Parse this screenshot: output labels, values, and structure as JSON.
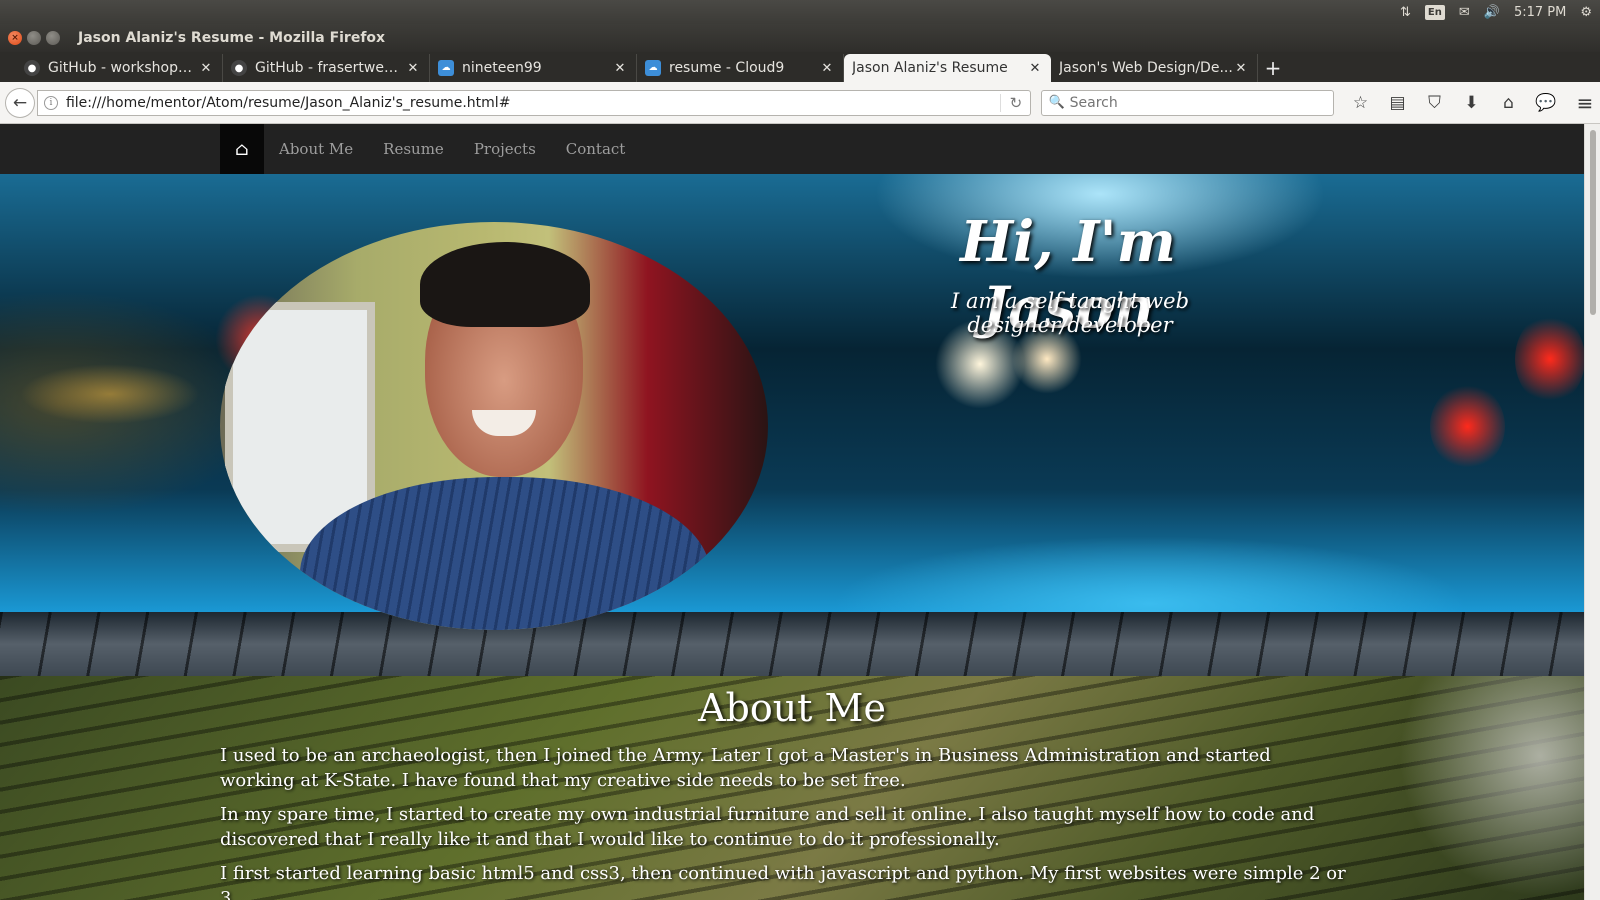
{
  "system": {
    "lang": "En",
    "clock": "5:17 PM"
  },
  "window": {
    "title": "Jason Alaniz's Resume - Mozilla Firefox"
  },
  "tabs": [
    {
      "label": "GitHub - workshopp...",
      "favicon": "github-icon"
    },
    {
      "label": "GitHub - frasertwee...",
      "favicon": "github-icon"
    },
    {
      "label": "nineteen99",
      "favicon": "cloud9-icon"
    },
    {
      "label": "resume - Cloud9",
      "favicon": "cloud9-icon"
    },
    {
      "label": "Jason Alaniz's Resume",
      "favicon": "none",
      "active": true
    },
    {
      "label": "Jason's Web Design/De...",
      "favicon": "none"
    }
  ],
  "navbar": {
    "url": "file:///home/mentor/Atom/resume/Jason_Alaniz's_resume.html#",
    "search_placeholder": "Search"
  },
  "site_nav": {
    "links": [
      "About Me",
      "Resume",
      "Projects",
      "Contact"
    ]
  },
  "hero": {
    "title": "Hi, I'm Jason",
    "subtitle": "I am a self taught web designer/developer"
  },
  "about": {
    "heading": "About Me",
    "paragraphs": [
      "I used to be an archaeologist, then I joined the Army. Later I got a Master's in Business Administration and started working at K-State. I have found that my creative side needs to be set free.",
      "In my spare time, I started to create my own industrial furniture and sell it online. I also taught myself how to code and discovered that I really like it and that I would like to continue to do it professionally.",
      "I first started learning basic html5 and css3, then continued with javascript and python. My first websites were simple 2 or 3"
    ]
  },
  "colors": {
    "site_nav_bg": "#222222",
    "site_nav_link": "#9d9d9d",
    "close_button": "#df4a16"
  }
}
